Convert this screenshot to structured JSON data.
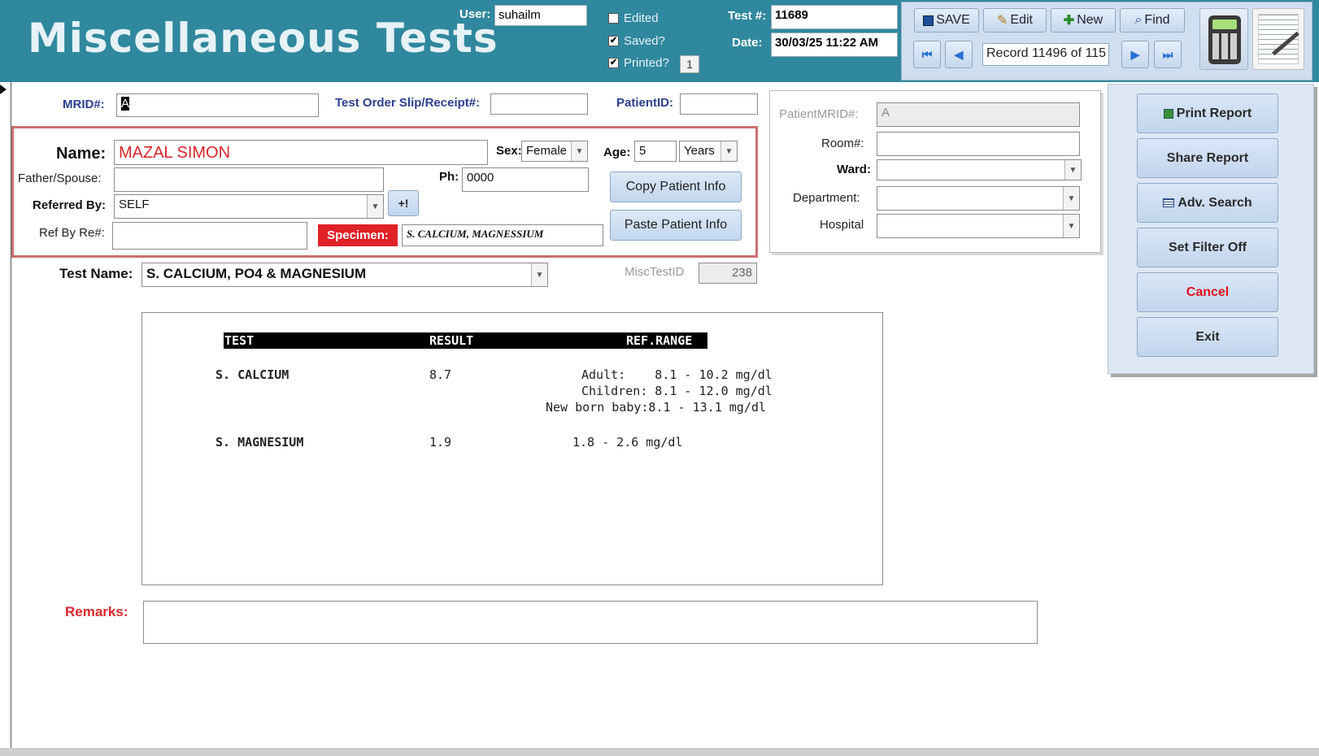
{
  "header": {
    "title": "Miscellaneous Tests",
    "user_label": "User:",
    "user_value": "suhailm",
    "edited_label": "Edited",
    "saved_label": "Saved?",
    "printed_label": "Printed?",
    "printed_count": "1",
    "edited_checked": "",
    "saved_checked": "✔",
    "printed_checked": "✔",
    "test_no_label": "Test #:",
    "test_no_value": "11689",
    "date_label": "Date:",
    "date_value": "30/03/25 11:22 AM"
  },
  "toolbar": {
    "save_label": "SAVE",
    "edit_label": "Edit",
    "new_label": "New",
    "find_label": "Find",
    "record_text": "Record 11496 of 115",
    "first_icon": "first-record-icon",
    "prev_icon": "previous-record-icon",
    "next_icon": "next-record-icon",
    "last_icon": "last-record-icon"
  },
  "form": {
    "mrid_label": "MRID#:",
    "mrid_value": "A",
    "slip_label": "Test Order Slip/Receipt#:",
    "slip_value": "",
    "patientid_label": "PatientID:",
    "patientid_value": "",
    "name_label": "Name:",
    "name_value": "MAZAL SIMON",
    "sex_label": "Sex:",
    "sex_value": "Female",
    "age_label": "Age:",
    "age_value": "5",
    "age_unit": "Years",
    "father_label": "Father/Spouse:",
    "father_value": "",
    "ph_label": "Ph:",
    "ph_value": "0000",
    "referred_label": "Referred By:",
    "referred_value": "SELF",
    "add_ref_label": "+!",
    "refbyre_label": "Ref By Re#:",
    "refbyre_value": "",
    "specimen_label": "Specimen:",
    "specimen_value": "S. CALCIUM, MAGNESSIUM",
    "copy_label": "Copy Patient Info",
    "paste_label": "Paste Patient Info",
    "test_name_label": "Test Name:",
    "test_name_value": "S. CALCIUM, PO4 & MAGNESIUM",
    "misc_id_label": "MiscTestID",
    "misc_id_value": "238",
    "remarks_label": "Remarks:",
    "remarks_value": ""
  },
  "right_info": {
    "patient_mrid_label": "PatientMRID#:",
    "patient_mrid_value": "A",
    "room_label": "Room#:",
    "room_value": "",
    "ward_label": "Ward:",
    "ward_value": "",
    "dept_label": "Department:",
    "dept_value": "",
    "hospital_label": "Hospital",
    "hospital_value": ""
  },
  "actions": {
    "print_label": "Print Report",
    "share_label": "Share Report",
    "adv_label": "Adv. Search",
    "filter_label": "Set Filter Off",
    "cancel_label": "Cancel",
    "exit_label": "Exit"
  },
  "report": {
    "col_test": "TEST",
    "col_result": "RESULT",
    "col_range": "REF.RANGE",
    "rows": [
      {
        "test": "S. CALCIUM",
        "result": "8.7",
        "range_lines": [
          "Adult:    8.1 - 10.2 mg/dl",
          "Children: 8.1 - 12.0 mg/dl",
          "New born baby:8.1 - 13.1 mg/dl"
        ]
      },
      {
        "test": "S. MAGNESIUM",
        "result": "1.9",
        "range_lines": [
          "1.8 - 2.6 mg/dl"
        ]
      }
    ]
  },
  "colors": {
    "header_bg": "#30889e",
    "name_red": "#d9262b",
    "specimen_red": "#e02128",
    "cancel_red": "#e0101a",
    "label_blue": "#2b3f8f"
  }
}
